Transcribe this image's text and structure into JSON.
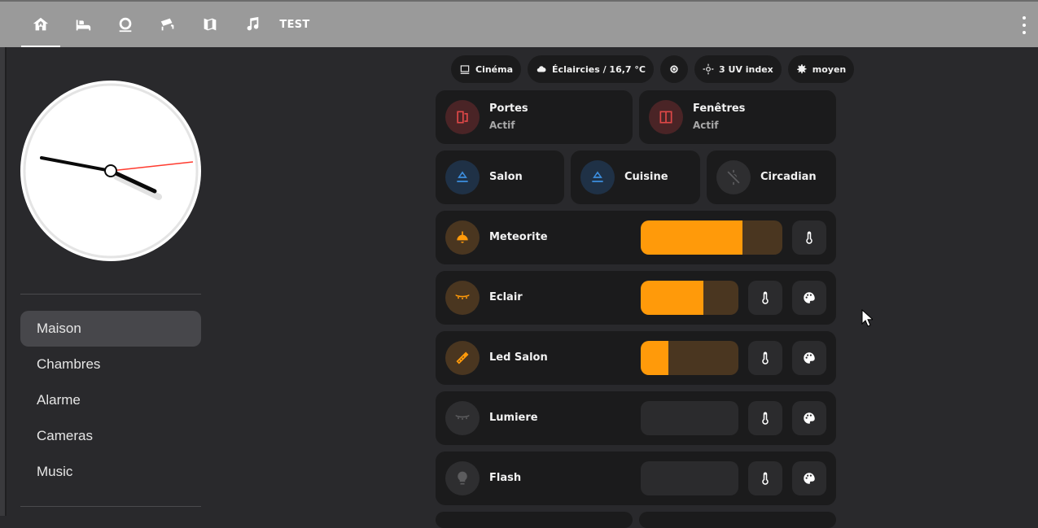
{
  "topbar": {
    "tabs": [
      {
        "icon": "home-icon"
      },
      {
        "icon": "bed-icon"
      },
      {
        "icon": "alarm-bell-icon"
      },
      {
        "icon": "cctv-icon"
      },
      {
        "icon": "map-icon"
      },
      {
        "icon": "music-note-icon"
      }
    ],
    "text_tab": "TEST"
  },
  "sidebar": {
    "items": [
      {
        "label": "Maison",
        "active": true
      },
      {
        "label": "Chambres"
      },
      {
        "label": "Alarme"
      },
      {
        "label": "Cameras"
      },
      {
        "label": "Music"
      }
    ]
  },
  "chips": {
    "scene": "Cinéma",
    "weather": "Éclaircies / 16,7 °C",
    "uv": "3 UV index",
    "level": "moyen"
  },
  "cards": {
    "doors": {
      "title": "Portes",
      "state": "Actif"
    },
    "windows": {
      "title": "Fenêtres",
      "state": "Actif"
    },
    "salon": {
      "title": "Salon"
    },
    "cuisine": {
      "title": "Cuisine"
    },
    "circadian": {
      "title": "Circadian"
    },
    "meteorite": {
      "title": "Meteorite",
      "brightness_pct": 72
    },
    "eclair": {
      "title": "Eclair",
      "brightness_pct": 64
    },
    "led_salon": {
      "title": "Led Salon",
      "brightness_pct": 28
    },
    "lumiere": {
      "title": "Lumiere",
      "brightness_pct": 0
    },
    "flash": {
      "title": "Flash",
      "brightness_pct": 0
    }
  },
  "colors": {
    "accent": "#ff9a0a",
    "alert_red": "#e04848",
    "blue": "#3d8fe0",
    "card_bg": "#1b1b1c",
    "page_bg": "#29292c"
  }
}
